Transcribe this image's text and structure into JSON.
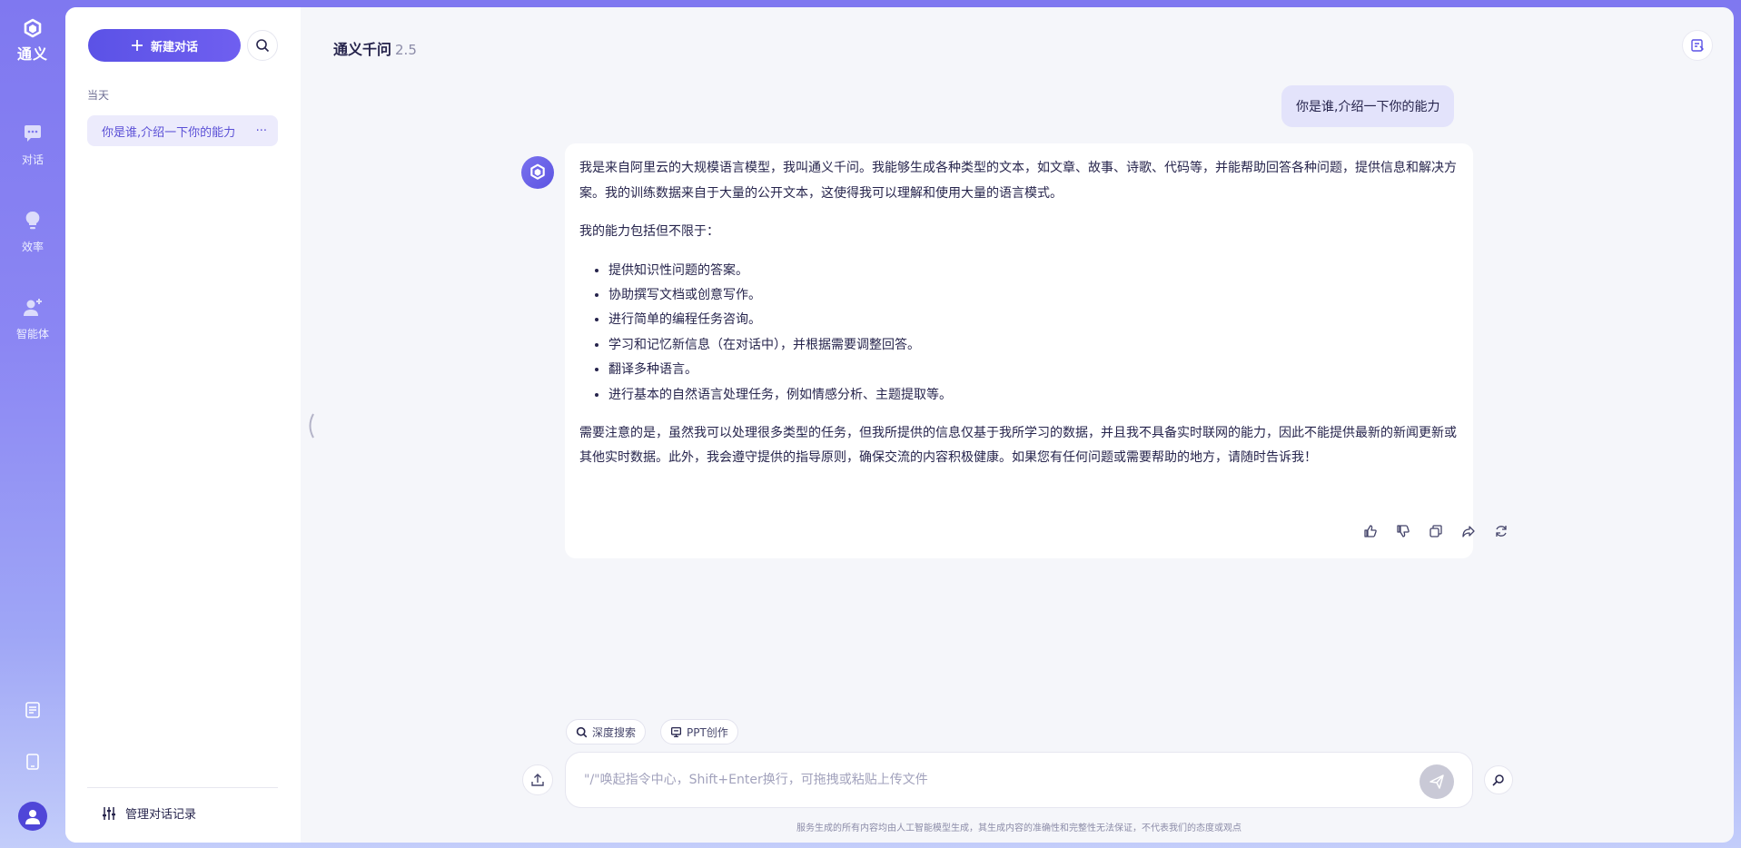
{
  "app": {
    "brand_name": "通义",
    "model_name": "通义千问",
    "model_version": "2.5"
  },
  "rail": {
    "items": [
      {
        "label": "对话",
        "icon": "chat-bubble-icon"
      },
      {
        "label": "效率",
        "icon": "lightbulb-icon"
      },
      {
        "label": "智能体",
        "icon": "agent-icon"
      }
    ],
    "bottom_icons": [
      "document-icon",
      "tablet-icon",
      "user-avatar-icon"
    ]
  },
  "sidebar": {
    "new_chat_label": "新建对话",
    "section_label": "当天",
    "history": [
      {
        "title": "你是谁,介绍一下你的能力",
        "more": "···"
      }
    ],
    "manage_label": "管理对话记录"
  },
  "conversation": {
    "user_message": "你是谁,介绍一下你的能力",
    "bot_intro": "我是来自阿里云的大规模语言模型，我叫通义千问。我能够生成各种类型的文本，如文章、故事、诗歌、代码等，并能帮助回答各种问题，提供信息和解决方案。我的训练数据来自于大量的公开文本，这使得我可以理解和使用大量的语言模式。",
    "bot_capabilities_heading": "我的能力包括但不限于：",
    "bot_capabilities": [
      "提供知识性问题的答案。",
      "协助撰写文档或创意写作。",
      "进行简单的编程任务咨询。",
      "学习和记忆新信息（在对话中），并根据需要调整回答。",
      "翻译多种语言。",
      "进行基本的自然语言处理任务，例如情感分析、主题提取等。"
    ],
    "bot_note": "需要注意的是，虽然我可以处理很多类型的任务，但我所提供的信息仅基于我所学习的数据，并且我不具备实时联网的能力，因此不能提供最新的新闻更新或其他实时数据。此外，我会遵守提供的指导原则，确保交流的内容积极健康。如果您有任何问题或需要帮助的地方，请随时告诉我！",
    "actions": [
      "thumbs-up-icon",
      "thumbs-down-icon",
      "copy-icon",
      "share-icon",
      "regenerate-icon"
    ]
  },
  "composer": {
    "chips": [
      {
        "label": "深度搜索",
        "icon": "search-icon"
      },
      {
        "label": "PPT创作",
        "icon": "ppt-icon"
      }
    ],
    "placeholder": "\"/\"唤起指令中心，Shift+Enter换行，可拖拽或粘贴上传文件",
    "disclaimer": "服务生成的所有内容均由人工智能模型生成，其生成内容的准确性和完整性无法保证，不代表我们的态度或观点"
  },
  "colors": {
    "accent": "#5b52e6",
    "rail_gradient_top": "#7f78f0",
    "bubble": "#e3e3fb"
  }
}
